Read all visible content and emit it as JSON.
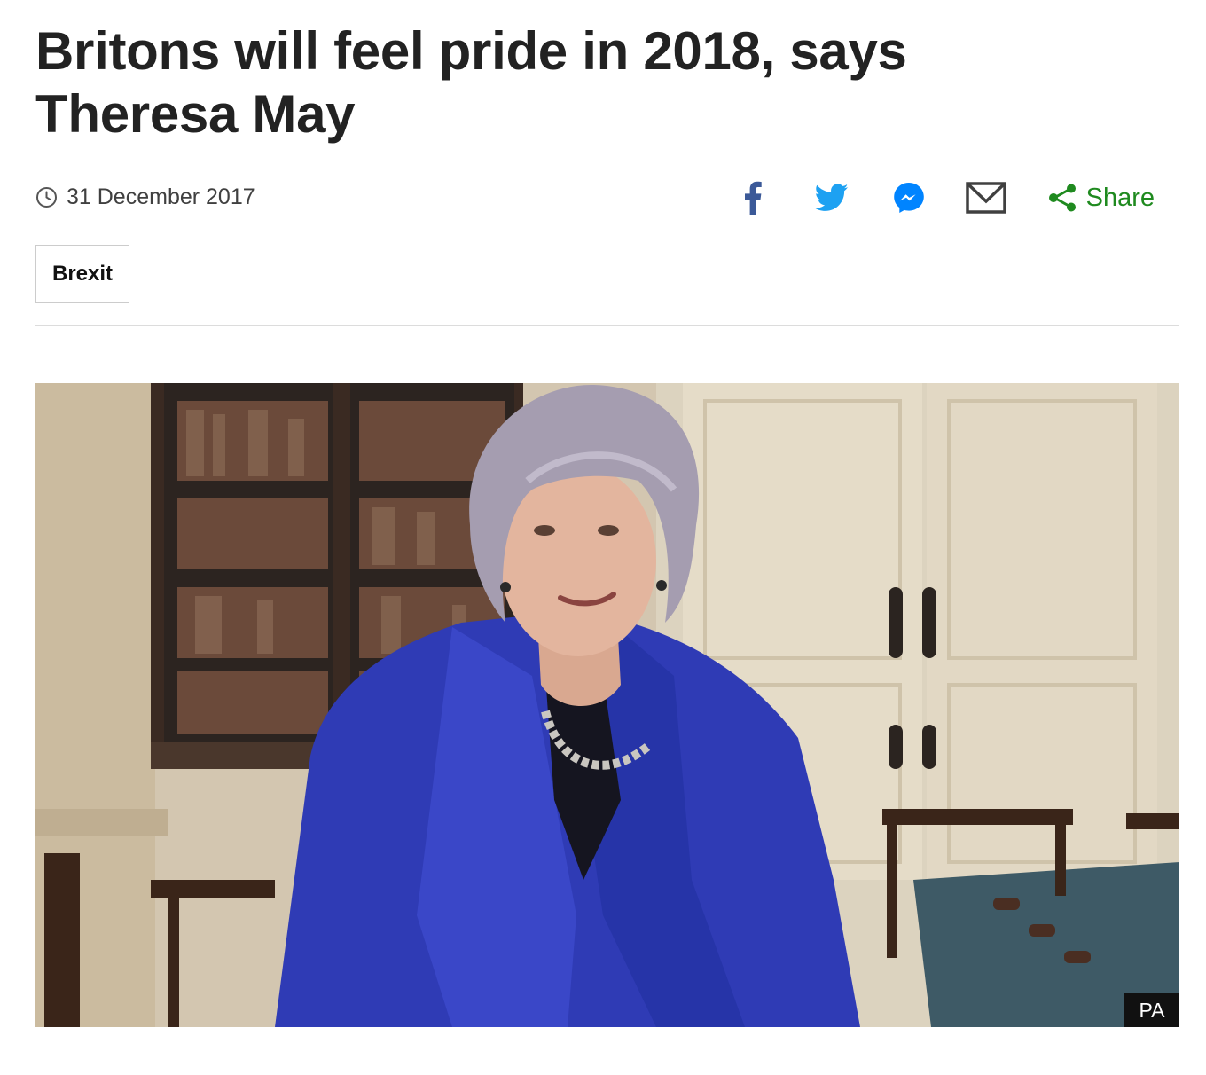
{
  "article": {
    "headline": "Britons will feel pride in 2018, says Theresa May",
    "date": "31 December 2017",
    "tag": "Brexit"
  },
  "share": {
    "buttons": [
      {
        "icon": "facebook-icon",
        "color": "#3b5998"
      },
      {
        "icon": "twitter-icon",
        "color": "#1da1f2"
      },
      {
        "icon": "messenger-icon",
        "color": "#0084ff"
      },
      {
        "icon": "email-icon",
        "color": "#404040"
      }
    ],
    "share_label": "Share",
    "share_color": "#1f8a1f"
  },
  "photo": {
    "credit": "PA"
  }
}
